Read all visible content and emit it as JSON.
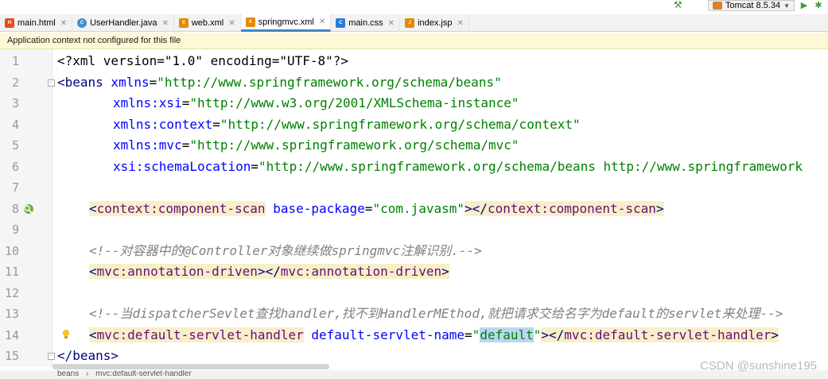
{
  "toolbar": {
    "run_config": "Tomcat 8.5.34"
  },
  "tabs": [
    {
      "label": "main.html",
      "icon": "html-file-icon",
      "color": "#e44d26"
    },
    {
      "label": "UserHandler.java",
      "icon": "java-class-icon",
      "color": "#3f8fd2"
    },
    {
      "label": "web.xml",
      "icon": "xml-file-icon",
      "color": "#e48a00"
    },
    {
      "label": "springmvc.xml",
      "icon": "xml-file-icon",
      "color": "#e48a00",
      "active": true
    },
    {
      "label": "main.css",
      "icon": "css-file-icon",
      "color": "#2b7bd6"
    },
    {
      "label": "index.jsp",
      "icon": "jsp-file-icon",
      "color": "#e48a00"
    }
  ],
  "notice": "Application context not configured for this file",
  "lines": {
    "l1": "1",
    "l2": "2",
    "l3": "3",
    "l4": "4",
    "l5": "5",
    "l6": "6",
    "l7": "7",
    "l8": "8",
    "l9": "9",
    "l10": "10",
    "l11": "11",
    "l12": "12",
    "l13": "13",
    "l14": "14",
    "l15": "15"
  },
  "code": {
    "c1": "<?xml version=\"1.0\" encoding=\"UTF-8\"?>",
    "c2_tag": "<beans",
    "c2_attr": " xmlns",
    "c2_eq": "=",
    "c2_val": "\"http://www.springframework.org/schema/beans\"",
    "c3_attr": "xmlns:xsi",
    "c3_val": "\"http://www.w3.org/2001/XMLSchema-instance\"",
    "c4_attr": "xmlns:context",
    "c4_val": "\"http://www.springframework.org/schema/context\"",
    "c5_attr": "xmlns:mvc",
    "c5_val": "\"http://www.springframework.org/schema/mvc\"",
    "c6_attr": "xsi:schemaLocation",
    "c6_val": "\"http://www.springframework.org/schema/beans http://www.springframework",
    "c8_open": "context:component-scan",
    "c8_attr": "base-package",
    "c8_val": "\"com.javasm\"",
    "c8_close": "context:component-scan",
    "c10": "<!--对容器中的@Controller对象继续做springmvc注解识别.-->",
    "c11_open": "mvc:annotation-driven",
    "c11_close": "mvc:annotation-driven",
    "c13": "<!--当dispatcherSevlet查找handler,找不到HandlerMEthod,就把请求交给名字为default的servlet来处理-->",
    "c14_open": "mvc:default-servlet-handler",
    "c14_attr": "default-servlet-name",
    "c14_val": "default",
    "c14_close": "mvc:default-servlet-handler",
    "c15": "</beans>"
  },
  "breadcrumb": [
    "beans",
    "mvc:default-servlet-handler"
  ],
  "watermark": "CSDN @sunshine195"
}
